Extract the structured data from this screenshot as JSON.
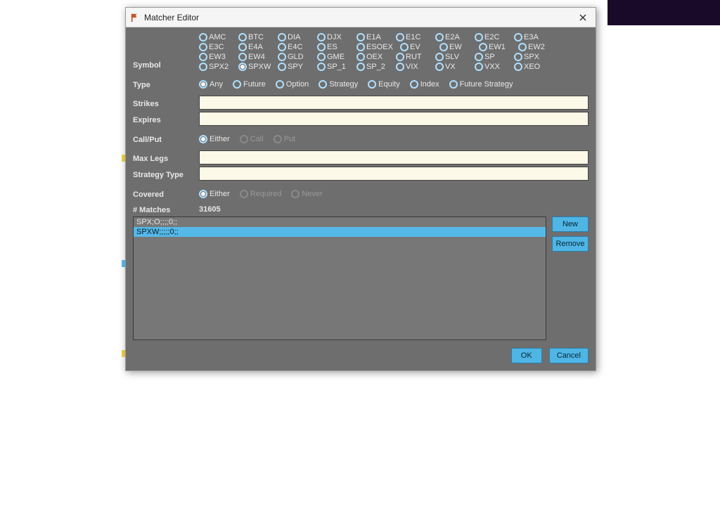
{
  "window": {
    "title": "Matcher Editor"
  },
  "labels": {
    "symbol": "Symbol",
    "type": "Type",
    "strikes": "Strikes",
    "expires": "Expires",
    "callput": "Call/Put",
    "maxlegs": "Max Legs",
    "strategytype": "Strategy Type",
    "covered": "Covered",
    "matches": "# Matches"
  },
  "symbols": {
    "options": [
      "AMC",
      "BTC",
      "DIA",
      "DJX",
      "E1A",
      "E1C",
      "E2A",
      "E2C",
      "E3A",
      "E3C",
      "E4A",
      "E4C",
      "ES",
      "ESOEX",
      "EV",
      "EW",
      "EW1",
      "EW2",
      "EW3",
      "EW4",
      "GLD",
      "GME",
      "OEX",
      "RUT",
      "SLV",
      "SP",
      "SPX",
      "SPX2",
      "SPXW",
      "SPY",
      "SP_1",
      "SP_2",
      "VIX",
      "VX",
      "VXX",
      "XEO"
    ],
    "selected": "SPXW"
  },
  "type": {
    "options": [
      "Any",
      "Future",
      "Option",
      "Strategy",
      "Equity",
      "Index",
      "Future Strategy"
    ],
    "selected": "Any"
  },
  "callput": {
    "options": [
      "Either",
      "Call",
      "Put"
    ],
    "selected": "Either",
    "disabled": [
      "Call",
      "Put"
    ]
  },
  "covered": {
    "options": [
      "Either",
      "Required",
      "Never"
    ],
    "selected": "Either",
    "disabled": [
      "Required",
      "Never"
    ]
  },
  "inputs": {
    "strikes": "",
    "expires": "",
    "maxlegs": "",
    "strategytype": ""
  },
  "matches_count": "31605",
  "list": {
    "items": [
      "SPX;O;;;;0;;",
      "SPXW;;;;;0;;"
    ],
    "selected_index": 1
  },
  "buttons": {
    "new": "New",
    "remove": "Remove",
    "ok": "OK",
    "cancel": "Cancel"
  }
}
